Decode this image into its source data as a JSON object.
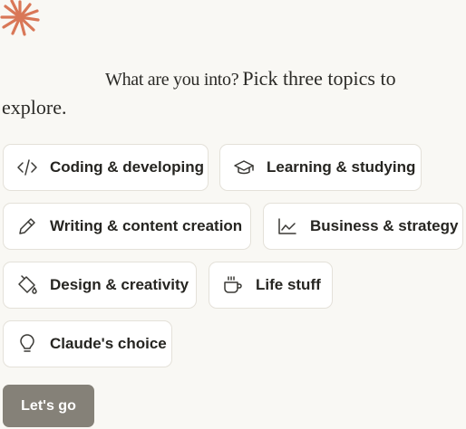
{
  "brand": {
    "accent": "#d97757",
    "icon": "starburst-icon"
  },
  "prompt": {
    "lead": "What are you into?",
    "emphasis": "Pick three topics to explore."
  },
  "topics": [
    {
      "label": "Coding & developing",
      "icon": "code-icon"
    },
    {
      "label": "Learning & studying",
      "icon": "graduation-cap-icon"
    },
    {
      "label": "Writing & content creation",
      "icon": "pencil-icon"
    },
    {
      "label": "Business & strategy",
      "icon": "line-chart-icon"
    },
    {
      "label": "Design & creativity",
      "icon": "paint-bucket-icon"
    },
    {
      "label": "Life stuff",
      "icon": "coffee-cup-icon"
    },
    {
      "label": "Claude's choice",
      "icon": "lightbulb-icon"
    }
  ],
  "action": {
    "label": "Let's go",
    "color": "#858178"
  }
}
